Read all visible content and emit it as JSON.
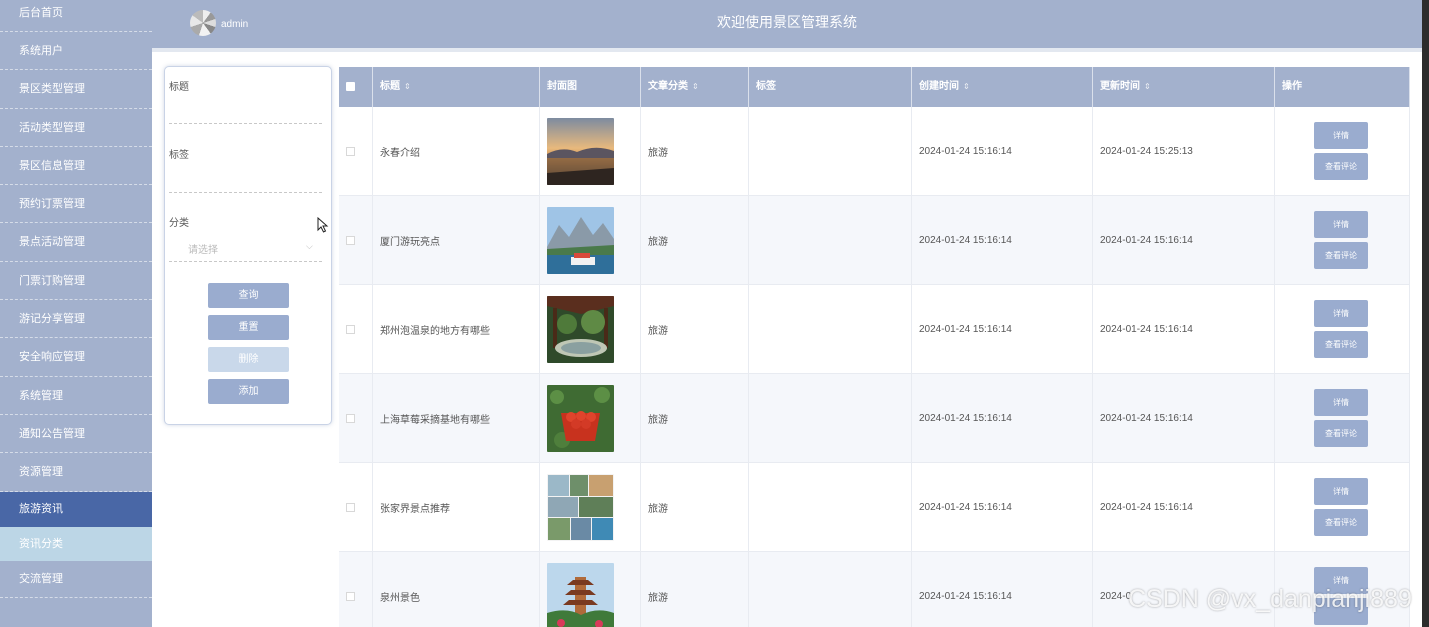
{
  "sidebar": {
    "items": [
      {
        "label": "后台首页",
        "state": "normal"
      },
      {
        "label": "系统用户",
        "state": "normal"
      },
      {
        "label": "景区类型管理",
        "state": "normal"
      },
      {
        "label": "活动类型管理",
        "state": "normal"
      },
      {
        "label": "景区信息管理",
        "state": "normal"
      },
      {
        "label": "预约订票管理",
        "state": "normal"
      },
      {
        "label": "景点活动管理",
        "state": "normal"
      },
      {
        "label": "门票订购管理",
        "state": "normal"
      },
      {
        "label": "游记分享管理",
        "state": "normal"
      },
      {
        "label": "安全响应管理",
        "state": "normal"
      },
      {
        "label": "系统管理",
        "state": "normal"
      },
      {
        "label": "通知公告管理",
        "state": "normal"
      },
      {
        "label": "资源管理",
        "state": "normal"
      },
      {
        "label": "旅游资讯",
        "state": "active"
      },
      {
        "label": "资讯分类",
        "state": "sub"
      },
      {
        "label": "交流管理",
        "state": "normal"
      }
    ]
  },
  "header": {
    "user": "admin",
    "title": "欢迎使用景区管理系统"
  },
  "search": {
    "title_label": "标题",
    "tag_label": "标签",
    "category_label": "分类",
    "category_placeholder": "请选择",
    "query_button": "查询",
    "reset_button": "重置",
    "delete_button": "删除",
    "add_button": "添加"
  },
  "table": {
    "headers": {
      "title": "标题",
      "cover": "封面图",
      "category": "文章分类",
      "tags": "标签",
      "created": "创建时间",
      "updated": "更新时间",
      "actions": "操作"
    },
    "rows": [
      {
        "title": "永春介绍",
        "category": "旅游",
        "tags": "",
        "created": "2024-01-24 15:16:14",
        "updated": "2024-01-24 15:25:13",
        "detail": "详情",
        "comments": "查看评论",
        "cover_icon": "sunset-lake-image"
      },
      {
        "title": "厦门游玩亮点",
        "category": "旅游",
        "tags": "",
        "created": "2024-01-24 15:16:14",
        "updated": "2024-01-24 15:16:14",
        "detail": "详情",
        "comments": "查看评论",
        "cover_icon": "boat-mountain-image"
      },
      {
        "title": "郑州泡温泉的地方有哪些",
        "category": "旅游",
        "tags": "",
        "created": "2024-01-24 15:16:14",
        "updated": "2024-01-24 15:16:14",
        "detail": "详情",
        "comments": "查看评论",
        "cover_icon": "hot-spring-image"
      },
      {
        "title": "上海草莓采摘基地有哪些",
        "category": "旅游",
        "tags": "",
        "created": "2024-01-24 15:16:14",
        "updated": "2024-01-24 15:16:14",
        "detail": "详情",
        "comments": "查看评论",
        "cover_icon": "strawberry-image"
      },
      {
        "title": "张家界景点推荐",
        "category": "旅游",
        "tags": "",
        "created": "2024-01-24 15:16:14",
        "updated": "2024-01-24 15:16:14",
        "detail": "详情",
        "comments": "查看评论",
        "cover_icon": "zhangjiajie-collage-image"
      },
      {
        "title": "泉州景色",
        "category": "旅游",
        "tags": "",
        "created": "2024-01-24 15:16:14",
        "updated": "2024-0",
        "detail": "详情",
        "comments": "",
        "cover_icon": "pagoda-image"
      }
    ]
  },
  "watermark": "CSDN @vx_danpianji889"
}
